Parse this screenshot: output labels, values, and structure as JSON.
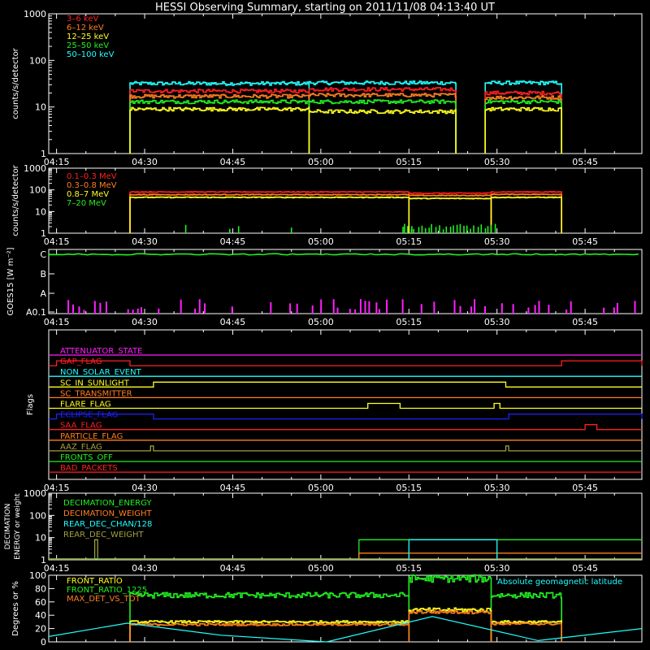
{
  "title": "HESSI Observing Summary, starting on 2011/11/08 04:13:40 UT",
  "time_axis": {
    "labels": [
      "04:15",
      "04:30",
      "04:45",
      "05:00",
      "05:15",
      "05:30",
      "05:45"
    ],
    "minutes": [
      0,
      15,
      30,
      45,
      60,
      75,
      90
    ],
    "range_minutes": [
      -1.33,
      99.67
    ],
    "note": "minutes after 04:15 UT"
  },
  "colors": {
    "red": "#ff2020",
    "orange": "#ff7f1e",
    "yellow": "#ffff20",
    "green": "#20f020",
    "cyan": "#20ffff",
    "magenta": "#ff20ff",
    "blue": "#2020ff",
    "olive": "#a0a040",
    "white": "#ffffff"
  },
  "chart_data": [
    {
      "id": "lowE",
      "type": "line",
      "ylabel": "counts/s/detector",
      "yscale": "log",
      "ylim": [
        1,
        1000
      ],
      "yticks": [
        1,
        10,
        100,
        1000
      ],
      "ytick_labels": [
        "1",
        "10",
        "100",
        "1000"
      ],
      "coverage_minutes": [
        [
          12.5,
          43.0
        ],
        [
          43.0,
          68.0
        ],
        [
          73.0,
          86.0
        ]
      ],
      "series": [
        {
          "name": "3–6 keV",
          "color": "#ff2020",
          "levels": [
            22,
            24,
            20,
            22
          ]
        },
        {
          "name": "6–12 keV",
          "color": "#ff7f1e",
          "levels": [
            17,
            18,
            16,
            16
          ]
        },
        {
          "name": "12–25 keV",
          "color": "#ffff20",
          "levels": [
            9,
            8,
            9,
            10
          ]
        },
        {
          "name": "25–50 keV",
          "color": "#20f020",
          "levels": [
            13,
            13,
            13,
            14
          ]
        },
        {
          "name": "50–100 keV",
          "color": "#20ffff",
          "levels": [
            32,
            33,
            33,
            33
          ]
        }
      ]
    },
    {
      "id": "highE",
      "type": "line",
      "ylabel": "counts/s/detector",
      "yscale": "log",
      "ylim": [
        1,
        1000
      ],
      "yticks": [
        1,
        10,
        100,
        1000
      ],
      "ytick_labels": [
        "1",
        "10",
        "100",
        "1000"
      ],
      "series": [
        {
          "name": "0.1–0.3 MeV",
          "color": "#ff2020",
          "levels": [
            80,
            70,
            80
          ]
        },
        {
          "name": "0.3–0.8 MeV",
          "color": "#ff7f1e",
          "levels": [
            60,
            55,
            62
          ]
        },
        {
          "name": "0.8–7 MeV",
          "color": "#ffff20",
          "levels": [
            45,
            40,
            45
          ]
        },
        {
          "name": "7–20 MeV",
          "color": "#20f020",
          "levels": [
            1,
            1,
            1
          ]
        }
      ]
    },
    {
      "id": "goes",
      "type": "line",
      "ylabel": "GOES15 [W m⁻²]",
      "ytick_labels": [
        "A0.1",
        "A",
        "B",
        "C"
      ],
      "series": [
        {
          "name": "",
          "color": "#20f020",
          "level_class": "C"
        },
        {
          "name": "",
          "color": "#ff20ff",
          "level_class": "A0.1"
        }
      ]
    },
    {
      "id": "flags",
      "type": "line",
      "ylabel": "Flags",
      "series": [
        {
          "name": "ATTENUATOR_STATE",
          "color": "#ff20ff",
          "on": []
        },
        {
          "name": "GAP_FLAG",
          "color": "#ff2020",
          "on": [
            [
              0,
              12.5
            ],
            [
              86,
              99.67
            ]
          ]
        },
        {
          "name": "NON_SOLAR_EVENT",
          "color": "#20ffff",
          "on": []
        },
        {
          "name": "SC_IN_SUNLIGHT",
          "color": "#ffff20",
          "on": [
            [
              16.5,
              76.5
            ]
          ]
        },
        {
          "name": "SC_TRANSMITTER",
          "color": "#ff7f1e",
          "on": []
        },
        {
          "name": "FLARE_FLAG",
          "color": "#ffff20",
          "on": [
            [
              53,
              58.5
            ],
            [
              74.5,
              75.5
            ]
          ]
        },
        {
          "name": "ECLIPSE_FLAG",
          "color": "#2020ff",
          "on": [
            [
              0,
              16.5
            ],
            [
              77,
              99.67
            ]
          ]
        },
        {
          "name": "SAA_FLAG",
          "color": "#ff2020",
          "on": [
            [
              90,
              92
            ]
          ]
        },
        {
          "name": "PARTICLE_FLAG",
          "color": "#ff7f1e",
          "on": []
        },
        {
          "name": "AAZ_FLAG",
          "color": "#a0a040",
          "on": [
            [
              16,
              16.5
            ],
            [
              76.5,
              77
            ]
          ]
        },
        {
          "name": "FRONTS_OFF",
          "color": "#20f020",
          "on": []
        },
        {
          "name": "BAD_PACKETS",
          "color": "#ff2020",
          "on": []
        }
      ]
    },
    {
      "id": "decim",
      "type": "line",
      "ylabel": "DECIMATION ENERGY or weight",
      "yscale": "log",
      "ylim": [
        1,
        1000
      ],
      "yticks": [
        1,
        10,
        100,
        1000
      ],
      "ytick_labels": [
        "1",
        "10",
        "100",
        "1000"
      ],
      "series": [
        {
          "name": "DECIMATION_ENERGY",
          "color": "#20f020",
          "steps": [
            [
              -1.33,
              0
            ],
            [
              51.5,
              8
            ],
            [
              99.67,
              8
            ]
          ]
        },
        {
          "name": "DECIMATION_WEIGHT",
          "color": "#ff7f1e",
          "steps": [
            [
              -1.33,
              0
            ],
            [
              51.5,
              2
            ],
            [
              99.67,
              2
            ]
          ]
        },
        {
          "name": "REAR_DEC_CHAN/128",
          "color": "#20ffff",
          "steps": [
            [
              -1.33,
              0
            ],
            [
              60,
              8
            ],
            [
              75,
              0
            ],
            [
              99.67,
              0
            ]
          ]
        },
        {
          "name": "REAR_DEC_WEIGHT",
          "color": "#a0a040",
          "steps": [
            [
              -1.33,
              0
            ],
            [
              6.5,
              8
            ],
            [
              7,
              0
            ],
            [
              51.5,
              0
            ],
            [
              99.67,
              0
            ]
          ]
        }
      ]
    },
    {
      "id": "ratio",
      "type": "line",
      "ylabel": "Degrees or %",
      "ylim": [
        0,
        100
      ],
      "yticks": [
        0,
        20,
        40,
        60,
        80,
        100
      ],
      "ytick_labels": [
        "0",
        "20",
        "40",
        "60",
        "80",
        "100"
      ],
      "annotation": "Absolute geomagnetic latitude",
      "series": [
        {
          "name": "FRONT_RATIO",
          "color": "#ffff20",
          "levels": [
            30,
            48,
            30
          ]
        },
        {
          "name": "FRONT_RATIO_1225",
          "color": "#20f020",
          "levels": [
            70,
            95,
            70
          ]
        },
        {
          "name": "MAX_DET_VS_TOT",
          "color": "#ff7f1e",
          "levels": [
            26,
            45,
            27
          ]
        },
        {
          "name": "",
          "color": "#20ffff",
          "points": [
            [
              -1.33,
              8
            ],
            [
              12,
              28
            ],
            [
              28,
              10
            ],
            [
              46,
              0
            ],
            [
              64,
              38
            ],
            [
              82,
              2
            ],
            [
              99.67,
              20
            ]
          ]
        }
      ]
    }
  ]
}
